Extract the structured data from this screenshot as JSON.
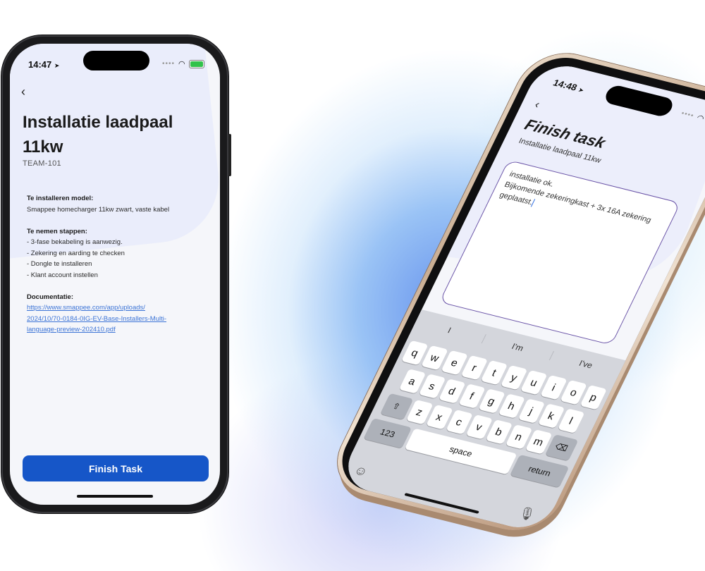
{
  "left_phone": {
    "status": {
      "time": "14:47"
    },
    "back_glyph": "‹",
    "title": "Installatie laadpaal 11kw",
    "code": "TEAM-101",
    "sections": {
      "model_heading": "Te installeren model:",
      "model_value": "Smappee homecharger 11kw zwart, vaste kabel",
      "steps_heading": "Te nemen stappen:",
      "steps": [
        "- 3-fase bekabeling is aanwezig.",
        "- Zekering en aarding te checken",
        "- Dongle te installeren",
        "- Klant account instellen"
      ],
      "docs_heading": "Documentatie:",
      "docs_link_lines": [
        "https://www.smappee.com/app/uploads/",
        "2024/10/70-0184-0IG-EV-Base-Installers-Multi-",
        "language-preview-202410.pdf"
      ]
    },
    "finish_button": "Finish Task"
  },
  "right_phone": {
    "status": {
      "time": "14:48"
    },
    "back_glyph": "‹",
    "title": "Finish task",
    "subtitle": "Installatie laadpaal 11kw",
    "note_text": "installatie ok.\nBijkomende zekeringkast + 3x 16A zekering geplaatst.",
    "keyboard": {
      "suggestions": [
        "I",
        "I'm",
        "I've"
      ],
      "row1": [
        "q",
        "w",
        "e",
        "r",
        "t",
        "y",
        "u",
        "i",
        "o",
        "p"
      ],
      "row2": [
        "a",
        "s",
        "d",
        "f",
        "g",
        "h",
        "j",
        "k",
        "l"
      ],
      "row3": [
        "z",
        "x",
        "c",
        "v",
        "b",
        "n",
        "m"
      ],
      "num_label": "123",
      "space_label": "space",
      "return_label": "return"
    }
  },
  "icons": {
    "shift": "⇧",
    "backspace": "⌫",
    "emoji": "☺",
    "mic": "🎙",
    "location": "➤",
    "wifi": "◠"
  },
  "colors": {
    "primary_button": "#1656c8",
    "link": "#3c74d6",
    "note_border": "#6b55a8",
    "battery": "#31c24a"
  }
}
